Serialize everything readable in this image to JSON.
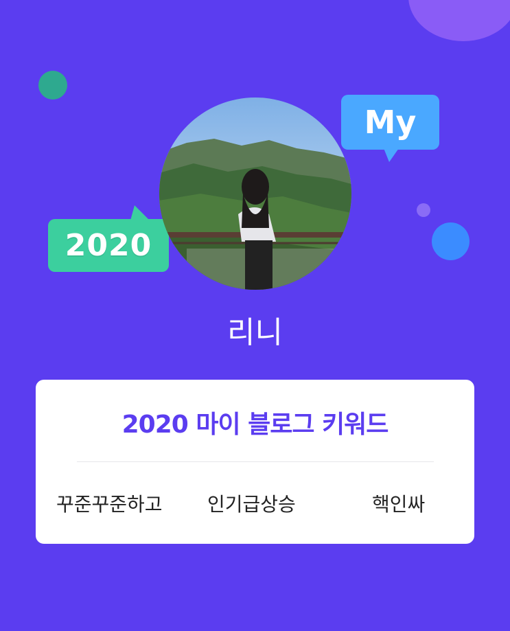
{
  "badges": {
    "year_bubble": "2020",
    "my_bubble": "My"
  },
  "profile": {
    "nickname": "리니",
    "avatar_alt": "profile photo"
  },
  "card": {
    "title": "2020 마이 블로그 키워드",
    "keywords": [
      "꾸준꾸준하고",
      "인기급상승",
      "핵인싸"
    ]
  },
  "colors": {
    "background": "#5b3df0",
    "accent": "#5b3df0",
    "year_bubble": "#3ccf9e",
    "my_bubble": "#4aa8ff"
  }
}
